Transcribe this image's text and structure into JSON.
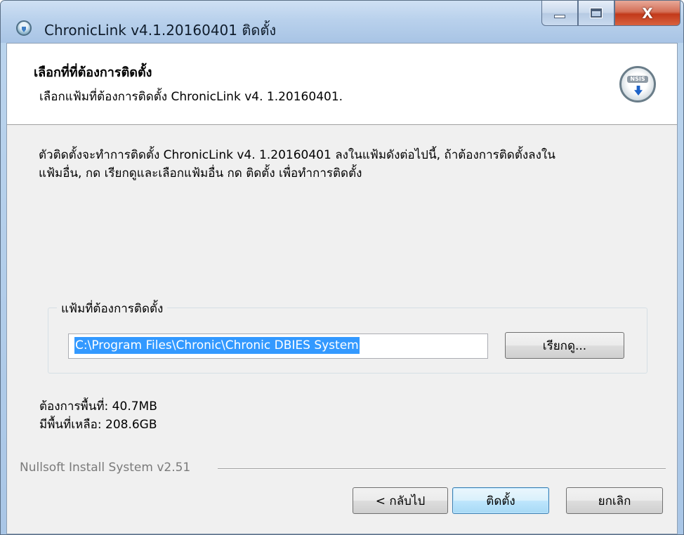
{
  "window": {
    "title": "ChronicLink v4.1.20160401 ติดตั้ง",
    "close_glyph": "X"
  },
  "header": {
    "title": "เลือกที่ที่ต้องการติดตั้ง",
    "subtitle": "เลือกแฟ้มที่ต้องการติดตั้ง ChronicLink v4. 1.20160401.",
    "icon": "nsis-install-icon",
    "icon_label": "NSIS"
  },
  "description": {
    "line1": "ตัวติดตั้งจะทำการติดตั้ง ChronicLink v4. 1.20160401 ลงในแฟ้มดังต่อไปนี้, ถ้าต้องการติดตั้งลงใน",
    "line2": "แฟ้มอื่น, กด เรียกดูและเลือกแฟ้มอื่น กด  ติดตั้ง เพื่อทำการติดตั้ง"
  },
  "destination": {
    "group_label": "แฟ้มที่ต้องการติดตั้ง",
    "path_value": "C:\\Program Files\\Chronic\\Chronic DBIES System",
    "browse_label": "เรียกดู..."
  },
  "space": {
    "required": "ต้องการพื้นที่: 40.7MB",
    "available": "มีพื้นที่เหลือ: 208.6GB"
  },
  "footer": {
    "branding": "Nullsoft Install System v2.51",
    "back_label": "< กลับไป",
    "install_label": "ติดตั้ง",
    "cancel_label": "ยกเลิก"
  }
}
